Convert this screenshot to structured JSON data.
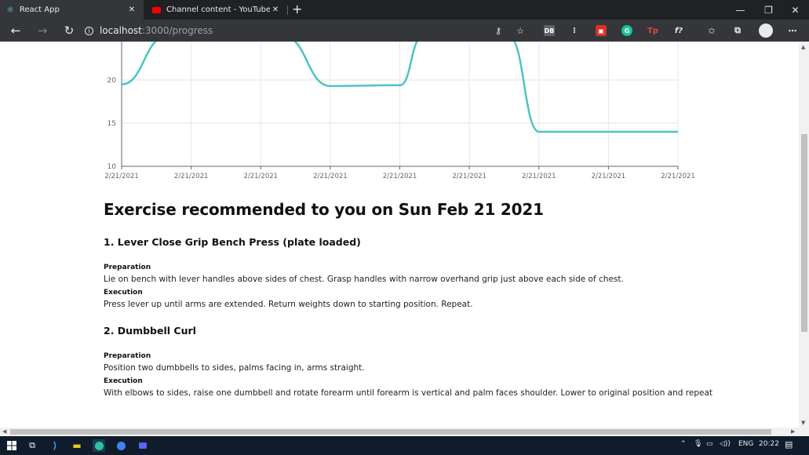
{
  "browser": {
    "tabs": [
      {
        "title": "React App",
        "active": true
      },
      {
        "title": "Channel content - YouTube Stud",
        "active": false
      }
    ],
    "url_host": "localhost",
    "url_path": ":3000/progress"
  },
  "chart_data": {
    "type": "line",
    "x": [
      "2/21/2021",
      "2/21/2021",
      "2/21/2021",
      "2/21/2021",
      "2/21/2021",
      "2/21/2021",
      "2/21/2021",
      "2/21/2021",
      "2/21/2021"
    ],
    "y_ticks": [
      10,
      15,
      20
    ],
    "ylim": [
      10,
      24.5
    ],
    "series": [
      {
        "color": "#4fc3c3",
        "values": [
          19.5,
          25,
          25,
          19.3,
          19.4,
          25,
          25,
          14,
          14,
          14
        ]
      }
    ]
  },
  "content": {
    "heading": "Exercise recommended to you on Sun Feb 21 2021",
    "exercises": [
      {
        "title": "1. Lever Close Grip Bench Press (plate loaded)",
        "prep_label": "Preparation",
        "prep": "Lie on bench with lever handles above sides of chest. Grasp handles with narrow overhand grip just above each side of chest.",
        "exec_label": "Execution",
        "exec": "Press lever up until arms are extended. Return weights down to starting position. Repeat."
      },
      {
        "title": "2. Dumbbell Curl",
        "prep_label": "Preparation",
        "prep": "Position two dumbbells to sides, palms facing in, arms straight.",
        "exec_label": "Execution",
        "exec": "With elbows to sides, raise one dumbbell and rotate forearm until forearm is vertical and palm faces shoulder. Lower to original position and repeat"
      }
    ]
  },
  "taskbar": {
    "language": "ENG",
    "time": "20:22"
  }
}
